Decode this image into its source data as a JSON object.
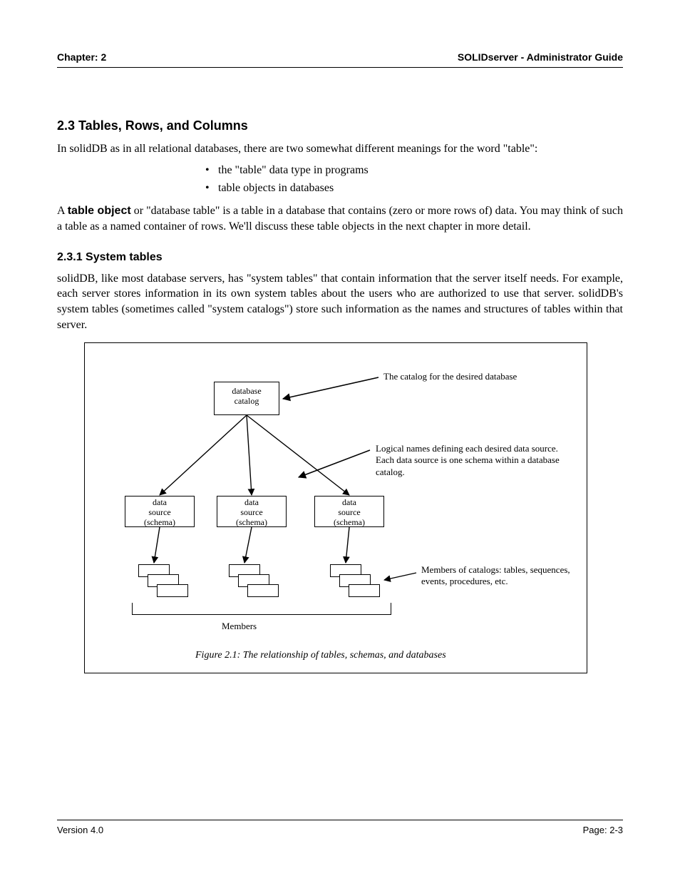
{
  "header": {
    "left": "Chapter: 2",
    "right": "SOLIDserver - Administrator Guide"
  },
  "body": {
    "section_title": "2.3 Tables, Rows, and Columns",
    "p1": "In solidDB as in all relational databases, there are two somewhat different meanings for the word \"table\":",
    "bullets": [
      "the \"table\" data type in programs",
      "table objects in databases"
    ],
    "p2_a": "A ",
    "p2_term": "table object",
    "p2_b": " or \"database table\" is a table in a database that contains (zero or more rows of) data. You may think of such a table as a named container of rows. We'll discuss these table objects in the next chapter in more detail.",
    "subsection_title": "2.3.1 System tables",
    "p3": "solidDB, like most database servers, has \"system tables\" that contain information that the server itself needs. For example, each server stores information in its own system tables about the users who are authorized to use that server. solidDB's system tables (sometimes called \"system catalogs\") store such information as the names and structures of tables within that server."
  },
  "figure": {
    "root_box_l1": "database",
    "root_box_l2": "catalog",
    "ds_box_l1": "data",
    "ds_box_l2": "source",
    "ds_box_l3": "(schema)",
    "label_catalog": "The catalog for the desired database",
    "label_ds": "Logical names defining each desired data source. Each data source is one schema within a database catalog.",
    "label_members": "Members of catalogs: tables, sequences, events, procedures, etc.",
    "bracket_label": "Members",
    "caption": "Figure 2.1: The relationship of tables, schemas, and databases"
  },
  "footer": {
    "left": "Version 4.0",
    "right": "Page: 2-3"
  }
}
